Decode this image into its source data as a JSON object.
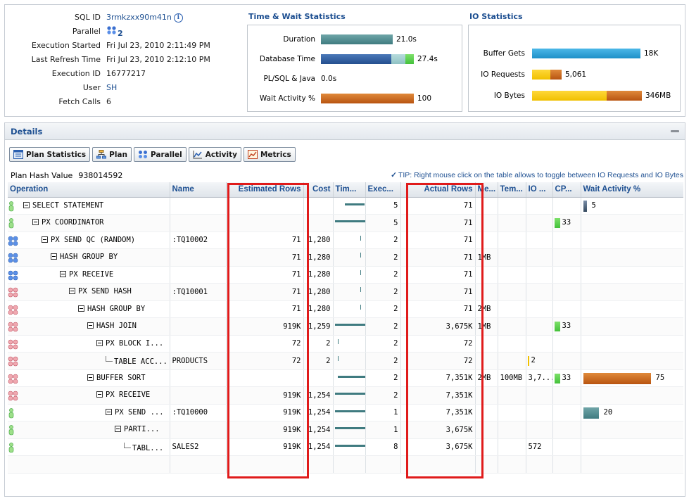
{
  "general": {
    "rows": [
      {
        "label": "SQL ID",
        "value": "3rmkzxx90m41n"
      },
      {
        "label": "Parallel",
        "value": "2"
      },
      {
        "label": "Execution Started",
        "value": "Fri Jul 23, 2010 2:11:49 PM"
      },
      {
        "label": "Last Refresh Time",
        "value": "Fri Jul 23, 2010 2:12:10 PM"
      },
      {
        "label": "Execution ID",
        "value": "16777217"
      },
      {
        "label": "User",
        "value": "SH"
      },
      {
        "label": "Fetch Calls",
        "value": "6"
      }
    ]
  },
  "time_wait": {
    "title": "Time & Wait Statistics",
    "rows": [
      {
        "label": "Duration",
        "value": "21.0s"
      },
      {
        "label": "Database Time",
        "value": "27.4s"
      },
      {
        "label": "PL/SQL & Java",
        "value": "0.0s"
      },
      {
        "label": "Wait Activity %",
        "value": "100"
      }
    ]
  },
  "io": {
    "title": "IO Statistics",
    "rows": [
      {
        "label": "Buffer Gets",
        "value": "18K"
      },
      {
        "label": "IO Requests",
        "value": "5,061"
      },
      {
        "label": "IO Bytes",
        "value": "346MB"
      }
    ]
  },
  "details": {
    "title": "Details",
    "tabs": [
      "Plan Statistics",
      "Plan",
      "Parallel",
      "Activity",
      "Metrics"
    ],
    "plan_hash_label": "Plan Hash Value",
    "plan_hash_value": "938014592",
    "tip": "TIP: Right mouse click on the table allows to toggle between IO Requests and IO Bytes"
  },
  "table": {
    "columns": [
      "Operation",
      "Name",
      "Estimated Rows",
      "Cost",
      "Tim...",
      "Exec...",
      "Actual Rows",
      "Me...",
      "Tem...",
      "IO ...",
      "CP...",
      "Wait Activity %"
    ],
    "rows": [
      {
        "op": "SELECT STATEMENT",
        "depth": 0,
        "icon": "green",
        "name": "",
        "est": "",
        "cost": "",
        "exec": "5",
        "actual": "71",
        "mem": "",
        "temp": "",
        "io": "",
        "cpu": "",
        "wait": "5"
      },
      {
        "op": "PX COORDINATOR",
        "depth": 1,
        "icon": "green",
        "name": "",
        "est": "",
        "cost": "",
        "exec": "5",
        "actual": "71",
        "mem": "",
        "temp": "",
        "io": "",
        "cpu": "33",
        "wait": ""
      },
      {
        "op": "PX SEND QC (RANDOM)",
        "depth": 2,
        "icon": "blue",
        "name": ":TQ10002",
        "est": "71",
        "cost": "1,280",
        "exec": "2",
        "actual": "71",
        "mem": "",
        "temp": "",
        "io": "",
        "cpu": "",
        "wait": ""
      },
      {
        "op": "HASH GROUP BY",
        "depth": 3,
        "icon": "blue",
        "name": "",
        "est": "71",
        "cost": "1,280",
        "exec": "2",
        "actual": "71",
        "mem": "1MB",
        "temp": "",
        "io": "",
        "cpu": "",
        "wait": ""
      },
      {
        "op": "PX RECEIVE",
        "depth": 4,
        "icon": "blue",
        "name": "",
        "est": "71",
        "cost": "1,280",
        "exec": "2",
        "actual": "71",
        "mem": "",
        "temp": "",
        "io": "",
        "cpu": "",
        "wait": ""
      },
      {
        "op": "PX SEND HASH",
        "depth": 5,
        "icon": "red",
        "name": ":TQ10001",
        "est": "71",
        "cost": "1,280",
        "exec": "2",
        "actual": "71",
        "mem": "",
        "temp": "",
        "io": "",
        "cpu": "",
        "wait": ""
      },
      {
        "op": "HASH GROUP BY",
        "depth": 6,
        "icon": "red",
        "name": "",
        "est": "71",
        "cost": "1,280",
        "exec": "2",
        "actual": "71",
        "mem": "2MB",
        "temp": "",
        "io": "",
        "cpu": "",
        "wait": ""
      },
      {
        "op": "HASH JOIN",
        "depth": 7,
        "icon": "red",
        "name": "",
        "est": "919K",
        "cost": "1,259",
        "exec": "2",
        "actual": "3,675K",
        "mem": "1MB",
        "temp": "",
        "io": "",
        "cpu": "33",
        "wait": ""
      },
      {
        "op": "PX BLOCK I...",
        "depth": 8,
        "icon": "red",
        "name": "",
        "est": "72",
        "cost": "2",
        "exec": "2",
        "actual": "72",
        "mem": "",
        "temp": "",
        "io": "",
        "cpu": "",
        "wait": ""
      },
      {
        "op": "TABLE ACC...",
        "depth": 9,
        "icon": "red",
        "leaf": true,
        "name": "PRODUCTS",
        "est": "72",
        "cost": "2",
        "exec": "2",
        "actual": "72",
        "mem": "",
        "temp": "",
        "io": "2",
        "cpu": "",
        "wait": ""
      },
      {
        "op": "BUFFER SORT",
        "depth": 7,
        "icon": "red",
        "name": "",
        "est": "",
        "cost": "",
        "exec": "2",
        "actual": "7,351K",
        "mem": "2MB",
        "temp": "100MB",
        "io": "3,7...",
        "cpu": "33",
        "wait": "75"
      },
      {
        "op": "PX RECEIVE",
        "depth": 8,
        "icon": "red",
        "name": "",
        "est": "919K",
        "cost": "1,254",
        "exec": "2",
        "actual": "7,351K",
        "mem": "",
        "temp": "",
        "io": "",
        "cpu": "",
        "wait": ""
      },
      {
        "op": "PX SEND ...",
        "depth": 9,
        "icon": "green",
        "name": ":TQ10000",
        "est": "919K",
        "cost": "1,254",
        "exec": "1",
        "actual": "7,351K",
        "mem": "",
        "temp": "",
        "io": "",
        "cpu": "",
        "wait": "20"
      },
      {
        "op": "PARTI...",
        "depth": 10,
        "icon": "green",
        "name": "",
        "est": "919K",
        "cost": "1,254",
        "exec": "1",
        "actual": "3,675K",
        "mem": "",
        "temp": "",
        "io": "",
        "cpu": "",
        "wait": ""
      },
      {
        "op": "TABL...",
        "depth": 11,
        "icon": "green",
        "leaf": true,
        "name": "SALES2",
        "est": "919K",
        "cost": "1,254",
        "exec": "8",
        "actual": "3,675K",
        "mem": "",
        "temp": "",
        "io": "572",
        "cpu": "",
        "wait": ""
      }
    ]
  },
  "colors": {
    "link": "#1d4f91",
    "teal": "#3f7b80",
    "navy": "#244f8e",
    "light_teal": "#8fc1c3",
    "green": "#44c13a",
    "orange": "#c8661a",
    "cyan": "#1e90c8",
    "yellow": "#f0c000",
    "highlight": "#e01b1b"
  }
}
